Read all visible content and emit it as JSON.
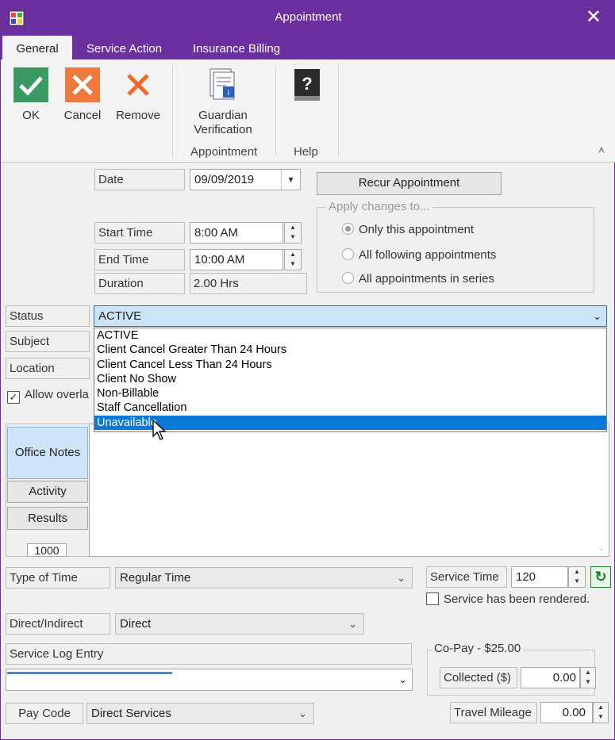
{
  "window": {
    "title": "Appointment",
    "close_glyph": "✕"
  },
  "tabs": [
    "General",
    "Service Action",
    "Insurance Billing"
  ],
  "ribbon": {
    "ok": "OK",
    "cancel": "Cancel",
    "remove": "Remove",
    "guardian_line1": "Guardian",
    "guardian_line2": "Verification",
    "group_appointment": "Appointment",
    "group_help": "Help",
    "help_icon": "?"
  },
  "form": {
    "date_label": "Date",
    "date_value": "09/09/2019",
    "recur_button": "Recur Appointment",
    "apply_title": "Apply changes to...",
    "radio_only": "Only this appointment",
    "radio_following": "All following appointments",
    "radio_series": "All appointments in series",
    "start_label": "Start Time",
    "start_value": "8:00 AM",
    "end_label": "End Time",
    "end_value": "10:00 AM",
    "duration_label": "Duration",
    "duration_value": "2.00 Hrs",
    "status_label": "Status",
    "status_value": "ACTIVE",
    "subject_label": "Subject",
    "location_label": "Location",
    "allow_overlap": "Allow overla"
  },
  "status_options": [
    "ACTIVE",
    "Client Cancel Greater Than 24 Hours",
    "Client Cancel Less Than 24 Hours",
    "Client No Show",
    "Non-Billable",
    "Staff Cancellation",
    "Unavailable"
  ],
  "status_highlighted": "Unavailable",
  "side_tabs": {
    "office_notes": "Office Notes",
    "activity": "Activity",
    "results": "Results",
    "counter": "1000"
  },
  "bottom": {
    "type_of_time_label": "Type of Time",
    "type_of_time_value": "Regular Time",
    "service_time_label": "Service Time",
    "service_time_value": "120",
    "rendered_label": "Service has been rendered.",
    "direct_label": "Direct/Indirect",
    "direct_value": "Direct",
    "service_log_label": "Service Log Entry",
    "copay_title": "Co-Pay - $25.00",
    "collected_label": "Collected ($)",
    "collected_value": "0.00",
    "pay_code_label": "Pay Code",
    "pay_code_value": "Direct Services",
    "mileage_label": "Travel Mileage",
    "mileage_value": "0.00"
  },
  "colors": {
    "titlebar": "#6b2fa0",
    "selection": "#0a78d7",
    "ok_green": "#3a9b62",
    "cancel_orange": "#ee7b3c"
  },
  "icons": [
    "app-icon",
    "close-icon",
    "ok-check-icon",
    "cancel-x-icon",
    "remove-x-icon",
    "guardian-document-icon",
    "help-book-icon",
    "collapse-ribbon-icon",
    "chevron-down-icon",
    "sync-icon",
    "mouse-cursor-icon"
  ]
}
